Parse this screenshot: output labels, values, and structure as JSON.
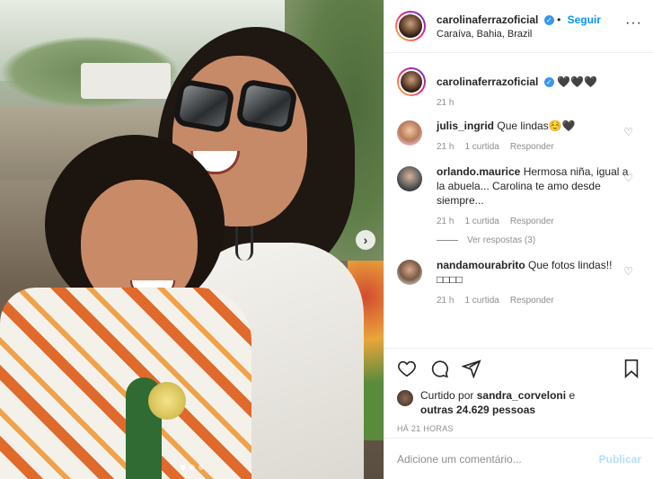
{
  "post": {
    "username": "carolinaferrazoficial",
    "follow_label": "Seguir",
    "location": "Caraíva, Bahia, Brazil",
    "more_icon": "ellipsis-icon",
    "caption": "🖤🖤🖤",
    "caption_time": "21 h"
  },
  "comments": [
    {
      "username": "julis_ingrid",
      "text": "Que lindas☺️🖤",
      "time": "21 h",
      "likes": "1 curtida",
      "reply": "Responder"
    },
    {
      "username": "orlando.maurice",
      "text": "Hermosa niña, igual a la abuela... Carolina te amo desde siempre...",
      "time": "21 h",
      "likes": "1 curtida",
      "reply": "Responder",
      "view_replies": "Ver respostas (3)"
    },
    {
      "username": "nandamourabrito",
      "text": "Que fotos lindas!!□□□□",
      "time": "21 h",
      "likes": "1 curtida",
      "reply": "Responder"
    }
  ],
  "likes": {
    "prefix": "Curtido por",
    "user": "sandra_corveloni",
    "mid": "e",
    "rest": "outras 24.629 pessoas"
  },
  "timestamp": "HÁ 21 HORAS",
  "add_comment": {
    "placeholder": "Adicione um comentário...",
    "publish_label": "Publicar"
  },
  "carousel": {
    "total": 3,
    "active": 1
  },
  "colors": {
    "accent": "#0095f6",
    "muted": "#8e8e8e",
    "publish_disabled": "#b2dffc"
  }
}
